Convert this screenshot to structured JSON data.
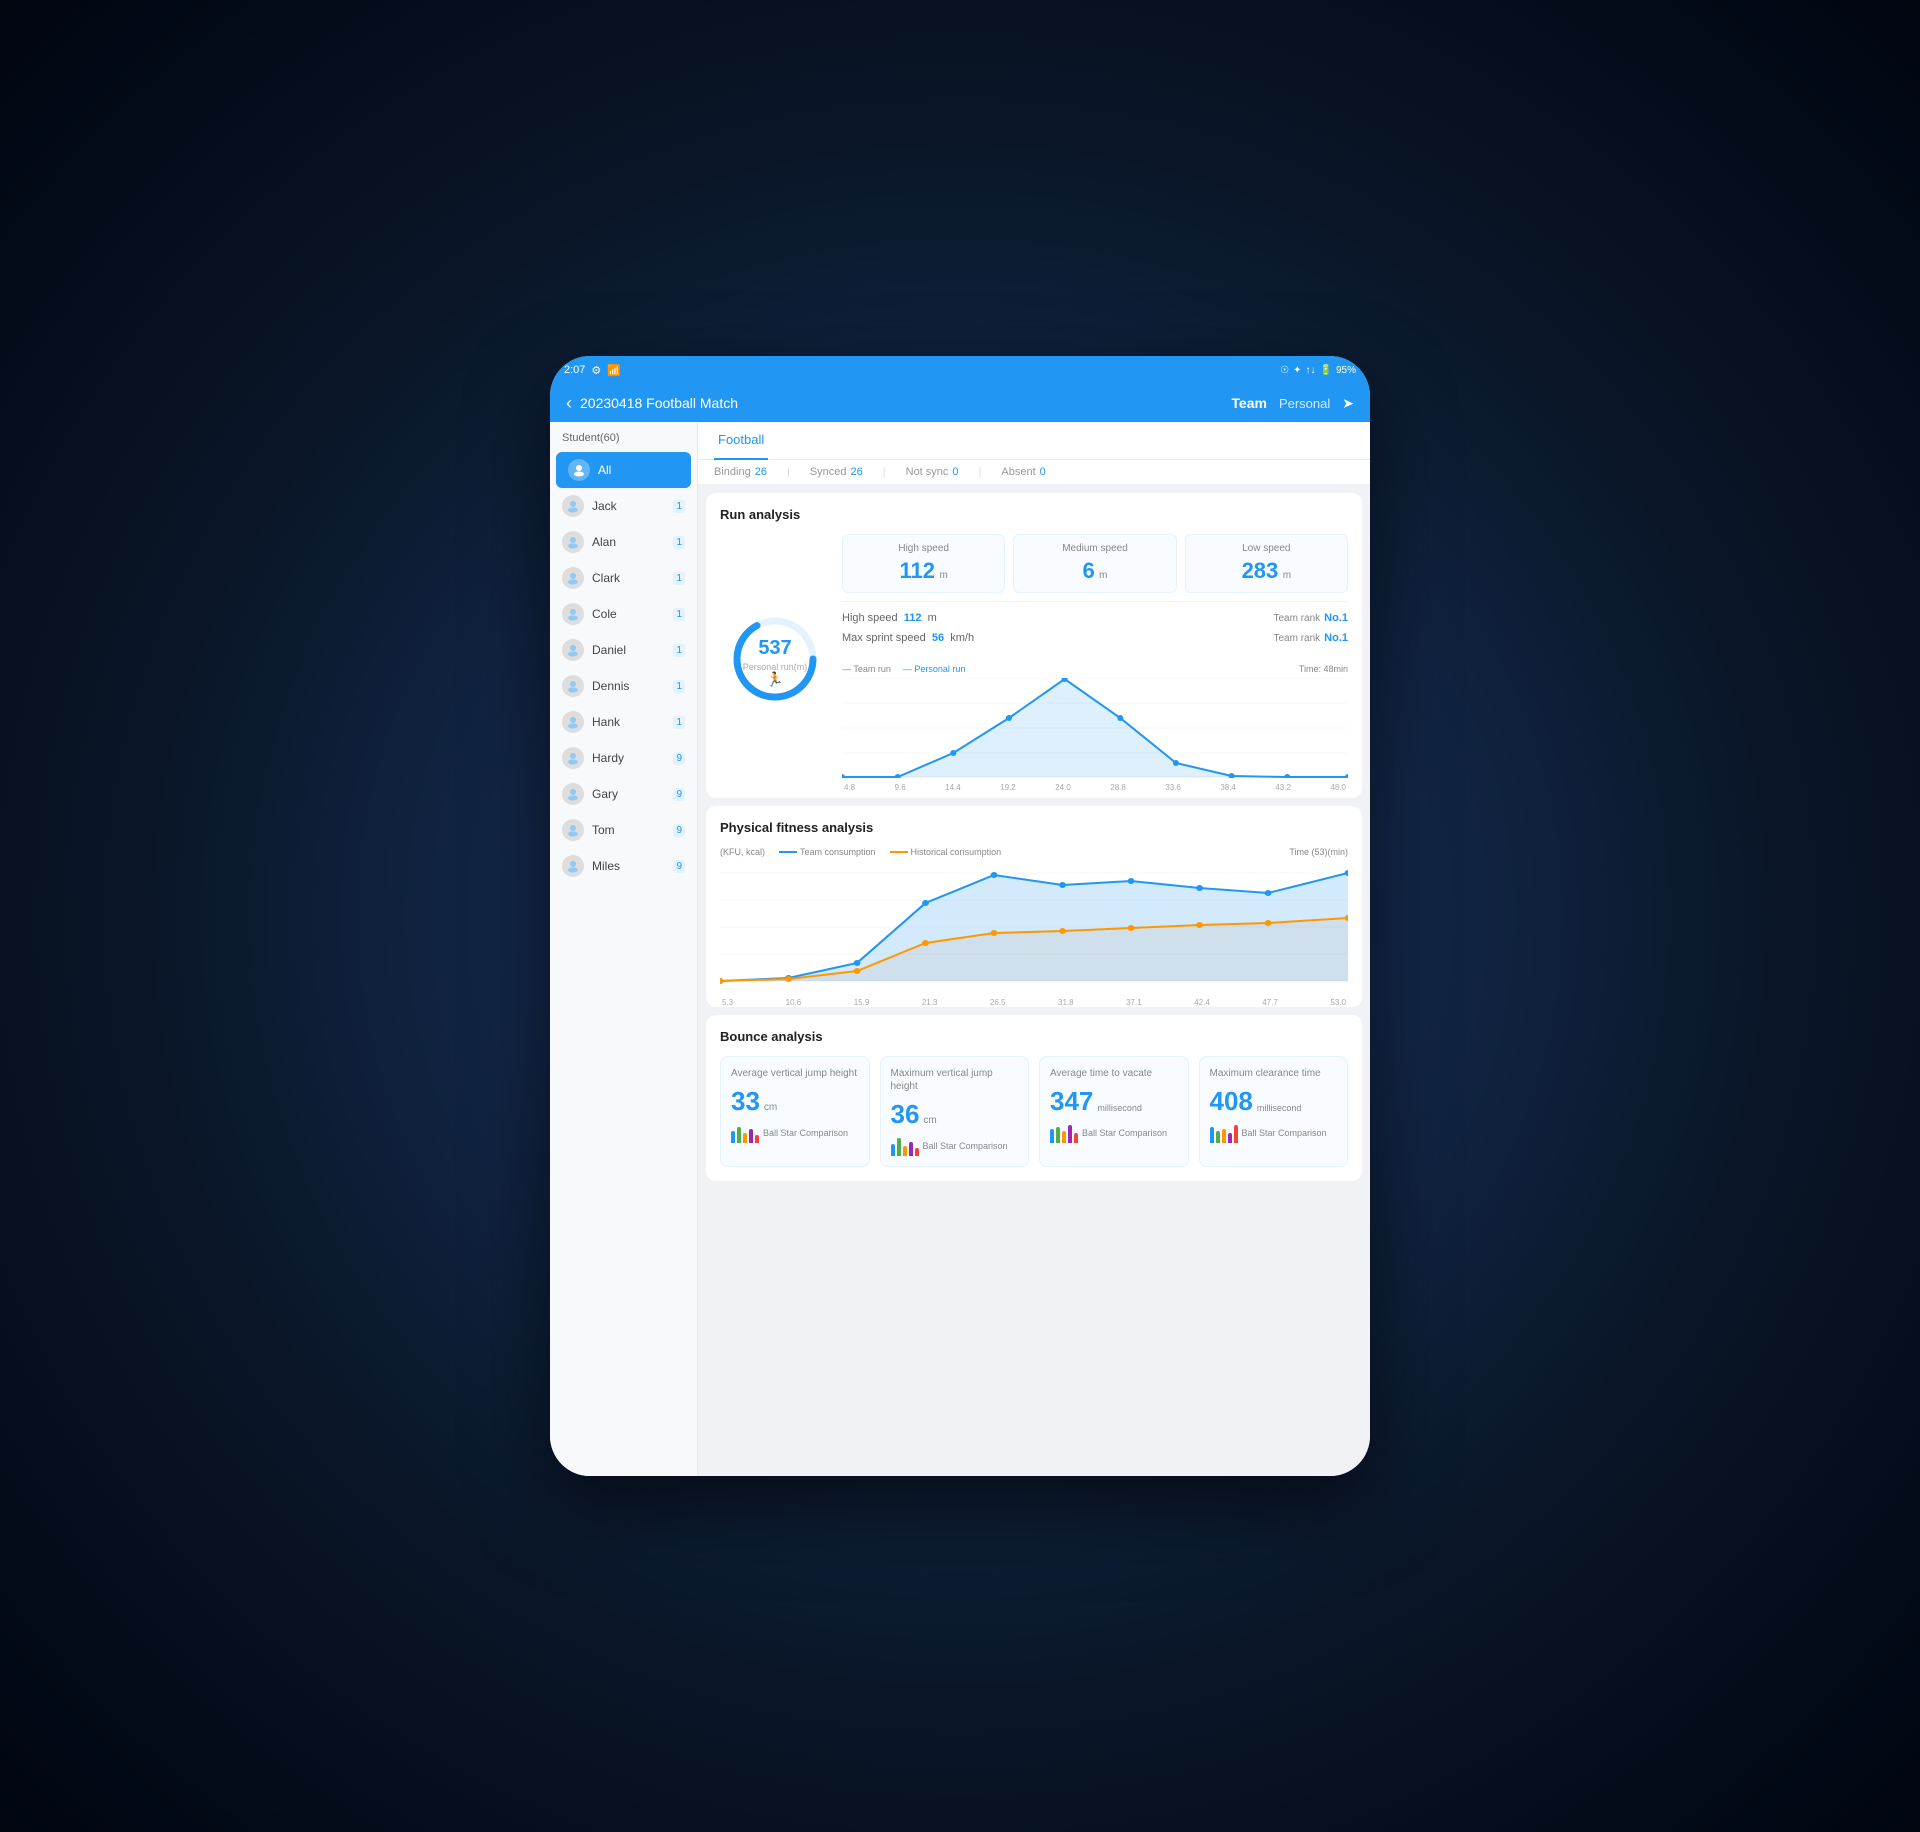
{
  "statusBar": {
    "time": "2:07",
    "batteryLevel": "95%"
  },
  "header": {
    "backLabel": "‹",
    "title": "20230418 Football Match",
    "teamLabel": "Team",
    "personalLabel": "Personal"
  },
  "sidebar": {
    "header": "Student(60)",
    "items": [
      {
        "name": "All",
        "badge": "",
        "active": true
      },
      {
        "name": "Jack",
        "badge": "1"
      },
      {
        "name": "Alan",
        "badge": "1"
      },
      {
        "name": "Clark",
        "badge": "1"
      },
      {
        "name": "Cole",
        "badge": "1"
      },
      {
        "name": "Daniel",
        "badge": "1"
      },
      {
        "name": "Dennis",
        "badge": "1"
      },
      {
        "name": "Hank",
        "badge": "1"
      },
      {
        "name": "Hardy",
        "badge": "9"
      },
      {
        "name": "Gary",
        "badge": "9"
      },
      {
        "name": "Tom",
        "badge": "9"
      },
      {
        "name": "Miles",
        "badge": "9"
      }
    ]
  },
  "tabs": [
    {
      "label": "Football",
      "active": true
    }
  ],
  "filterBar": {
    "binding": {
      "label": "Binding",
      "value": "26"
    },
    "synced": {
      "label": "Synced",
      "value": "26"
    },
    "notSync": {
      "label": "Not sync",
      "value": "0"
    },
    "absent": {
      "label": "Absent",
      "value": "0"
    }
  },
  "runAnalysis": {
    "title": "Run analysis",
    "totalRun": "537",
    "personalRunLabel": "Personal run(m)",
    "highSpeed": {
      "label": "High speed",
      "value": "112",
      "unit": "m"
    },
    "mediumSpeed": {
      "label": "Medium speed",
      "value": "6",
      "unit": "m"
    },
    "lowSpeed": {
      "label": "Low speed",
      "value": "283",
      "unit": "m"
    },
    "highSpeedDetail": "High speed  112  m",
    "highSpeedRankLabel": "Team rank",
    "highSpeedRank": "No.1",
    "maxSprintLabel": "Max sprint speed  56  km/h",
    "maxSprintRankLabel": "Team rank",
    "maxSprintRank": "No.1",
    "chartLegend": {
      "teamRun": "Team run",
      "personalRun": "Personal run"
    },
    "chartTimeLabel": "Time: 48min",
    "xAxis": [
      "4.8",
      "9.6",
      "14.4",
      "19.2",
      "24.0",
      "28.8",
      "33.6",
      "38.4",
      "43.2",
      "48.0"
    ],
    "yAxis": [
      "0",
      "51",
      "102",
      "153",
      "204"
    ],
    "personalRunData": [
      0,
      10,
      60,
      130,
      200,
      120,
      40,
      5,
      0,
      0
    ],
    "teamRunData": [
      0,
      15,
      70,
      140,
      180,
      110,
      35,
      8,
      0,
      0
    ]
  },
  "physicalFitness": {
    "title": "Physical fitness analysis",
    "yLabel": "(KFU, kcal)",
    "teamConsumptionLabel": "Team consumption",
    "historicalConsumptionLabel": "Historical consumption",
    "timeLabel": "Time (53)(min)",
    "yAxis": [
      "124",
      "248",
      "372",
      "496"
    ],
    "xAxis": [
      "5.3",
      "10.6",
      "15.9",
      "21.3",
      "26.5",
      "31.8",
      "37.1",
      "42.4",
      "47.7",
      "53.0"
    ],
    "teamData": [
      5,
      30,
      60,
      200,
      380,
      340,
      350,
      320,
      300,
      390
    ],
    "historicalData": [
      5,
      20,
      50,
      120,
      160,
      170,
      175,
      180,
      190,
      200
    ]
  },
  "bounceAnalysis": {
    "title": "Bounce analysis",
    "cards": [
      {
        "label": "Average vertical jump height",
        "value": "33",
        "unit": "cm",
        "compare": "Ball Star Comparison"
      },
      {
        "label": "Maximum vertical jump height",
        "value": "36",
        "unit": "cm",
        "compare": "Ball Star Comparison"
      },
      {
        "label": "Average time to vacate",
        "value": "347",
        "unit": "millisecond",
        "compare": "Ball Star Comparison"
      },
      {
        "label": "Maximum clearance time",
        "value": "408",
        "unit": "millisecond",
        "compare": "Ball Star Comparison"
      }
    ]
  }
}
